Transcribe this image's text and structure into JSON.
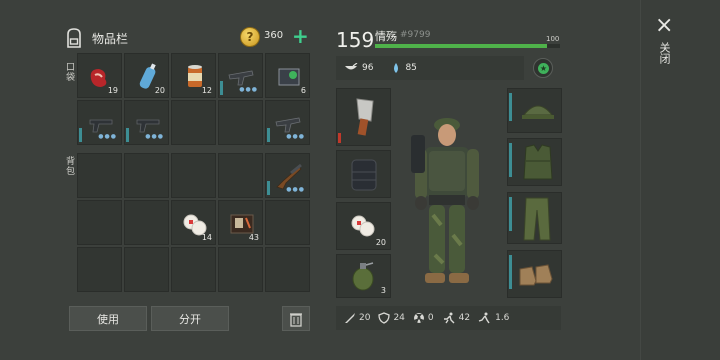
{
  "inventory": {
    "title": "物品栏",
    "coins": "360",
    "add_label": "+",
    "pocket_label": "口袋",
    "backpack_label": "背包",
    "pocket_row1": [
      {
        "icon": "raw-meat-icon",
        "count": "19"
      },
      {
        "icon": "water-bottle-icon",
        "count": "20"
      },
      {
        "icon": "canned-food-icon",
        "count": "12"
      },
      {
        "icon": "smg-icon",
        "count": ""
      },
      {
        "icon": "ammo-box-icon",
        "count": "6"
      }
    ],
    "pocket_row2": [
      {
        "icon": "pistol-icon",
        "count": ""
      },
      {
        "icon": "pistol-icon",
        "count": ""
      },
      {
        "icon": "",
        "count": ""
      },
      {
        "icon": "",
        "count": ""
      },
      {
        "icon": "smg-icon",
        "count": ""
      }
    ],
    "backpack_items": [
      {
        "icon": "shotgun-icon",
        "count": ""
      },
      {
        "icon": "bandage-icon",
        "count": "14"
      },
      {
        "icon": "repair-kit-icon",
        "count": "43"
      }
    ],
    "use_button": "使用",
    "split_button": "分开",
    "trash_icon": "trash-icon"
  },
  "character": {
    "hp": "159",
    "name": "情殇",
    "id": "#9799",
    "hp_max": "100",
    "hp_fraction": 0.93,
    "hunger": "96",
    "thirst": "85",
    "equip_left": [
      {
        "icon": "cleaver-icon",
        "count": ""
      },
      {
        "icon": "backpack-icon",
        "count": ""
      },
      {
        "icon": "bandage-icon",
        "count": "20"
      },
      {
        "icon": "grenade-icon",
        "count": "3"
      }
    ],
    "equip_right": [
      {
        "icon": "helmet-icon"
      },
      {
        "icon": "vest-icon"
      },
      {
        "icon": "pants-icon"
      },
      {
        "icon": "boots-icon"
      }
    ],
    "stats": [
      {
        "icon": "attack-icon",
        "value": "20"
      },
      {
        "icon": "defense-icon",
        "value": "24"
      },
      {
        "icon": "radiation-icon",
        "value": "0"
      },
      {
        "icon": "speed-icon",
        "value": "42"
      },
      {
        "icon": "stealth-icon",
        "value": "1.6"
      }
    ]
  },
  "close": {
    "label": "关闭",
    "icon": "×"
  },
  "colors": {
    "accent_green": "#3fcf8e",
    "hp_green": "#4fb24a",
    "durability_teal": "#3d8e94"
  }
}
